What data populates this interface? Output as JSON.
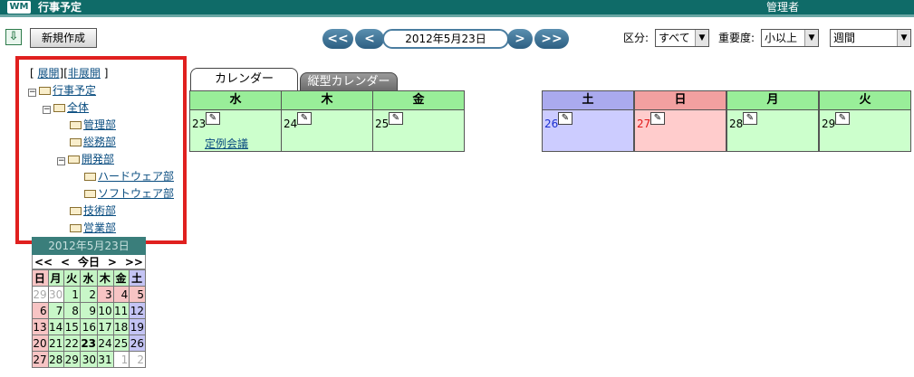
{
  "app": {
    "logo": "WM",
    "title": "行事予定",
    "user": "管理者"
  },
  "toolbar": {
    "download_icon": "arrow-down-icon",
    "new_button": "新規作成",
    "nav_prev_week": "<<",
    "nav_prev_day": "<",
    "current_date": "2012年5月23日",
    "nav_next_day": ">",
    "nav_next_week": ">>",
    "category_label": "区分:",
    "category_value": "すべて",
    "importance_label": "重要度:",
    "importance_value": "小以上",
    "view_value": "週間"
  },
  "tree": {
    "expand": "展開",
    "collapse": "非展開",
    "open_bracket": "[",
    "sep": "][",
    "close_bracket": "]",
    "items": [
      {
        "label": "行事予定",
        "toggle": "⊟"
      },
      {
        "label": "全体",
        "toggle": "⊟"
      },
      {
        "label": "管理部"
      },
      {
        "label": "総務部"
      },
      {
        "label": "開発部",
        "toggle": "⊟"
      },
      {
        "label": "ハードウェア部"
      },
      {
        "label": "ソフトウェア部"
      },
      {
        "label": "技術部"
      },
      {
        "label": "営業部"
      }
    ]
  },
  "minical": {
    "title": "2012年5月23日",
    "nav": [
      "<<",
      "<",
      "今日",
      ">",
      ">>"
    ],
    "weekdays": [
      "日",
      "月",
      "火",
      "水",
      "木",
      "金",
      "土"
    ],
    "weeks": [
      [
        "29",
        "30",
        "1",
        "2",
        "3",
        "4",
        "5"
      ],
      [
        "6",
        "7",
        "8",
        "9",
        "10",
        "11",
        "12"
      ],
      [
        "13",
        "14",
        "15",
        "16",
        "17",
        "18",
        "19"
      ],
      [
        "20",
        "21",
        "22",
        "23",
        "24",
        "25",
        "26"
      ],
      [
        "27",
        "28",
        "29",
        "30",
        "31",
        "1",
        "2"
      ]
    ]
  },
  "tabs": {
    "calendar": "カレンダー",
    "vertical_calendar": "縦型カレンダー"
  },
  "week": {
    "days": [
      {
        "name": "水",
        "date": "23",
        "event": "定例会議"
      },
      {
        "name": "木",
        "date": "24",
        "event": ""
      },
      {
        "name": "金",
        "date": "25",
        "event": ""
      },
      {
        "name": "土",
        "date": "26",
        "event": ""
      },
      {
        "name": "日",
        "date": "27",
        "event": ""
      },
      {
        "name": "月",
        "date": "28",
        "event": ""
      },
      {
        "name": "火",
        "date": "29",
        "event": ""
      }
    ]
  },
  "colors": {
    "titlebar": "#0f6b68",
    "weekday_head": "#99ee99",
    "weekday_body": "#ccffcc",
    "saturday_head": "#aaaaee",
    "saturday_body": "#ccccff",
    "sunday_head": "#f2a0a0",
    "sunday_body": "#ffcccc",
    "highlight_border": "#e0201f"
  }
}
